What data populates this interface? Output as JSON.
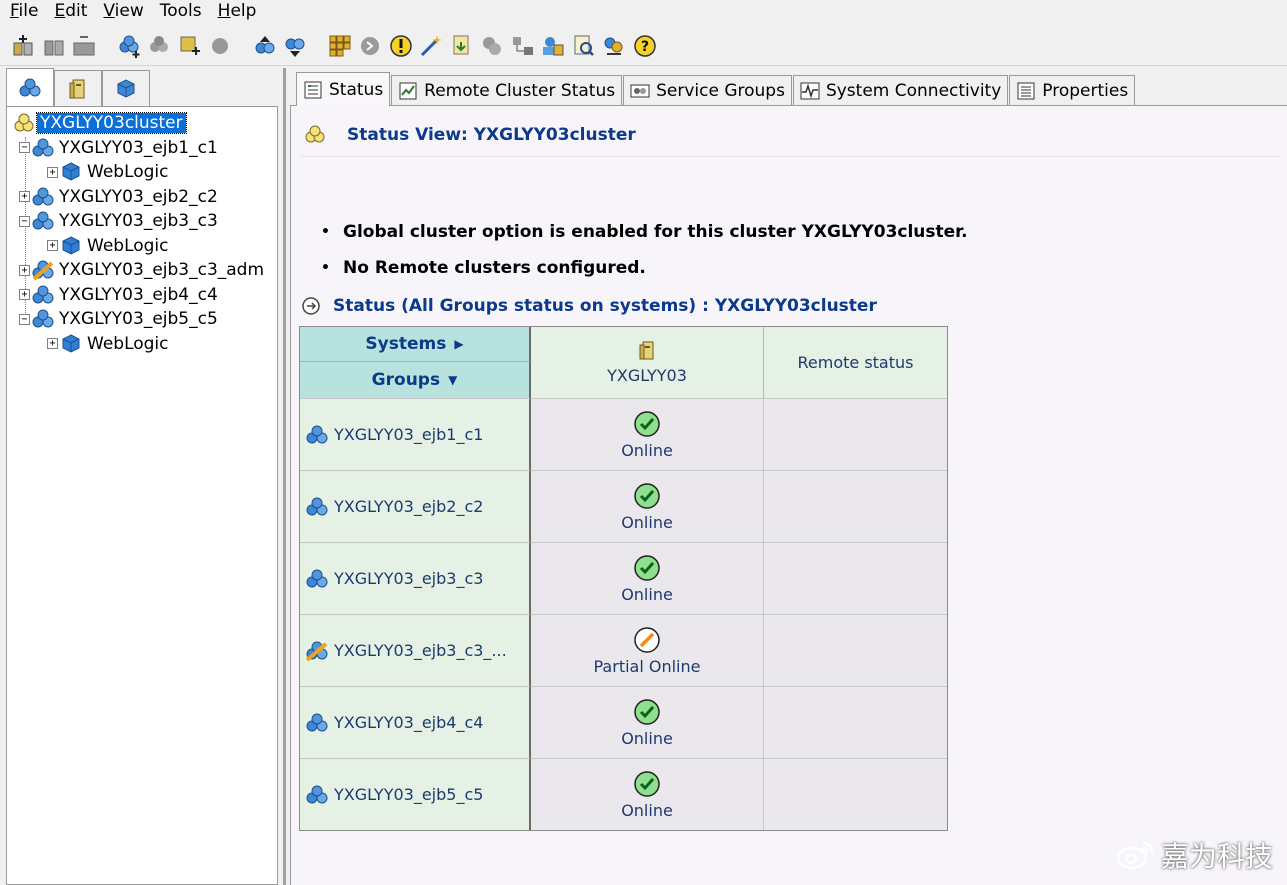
{
  "menu": [
    {
      "mnemonic": "F",
      "rest": "ile"
    },
    {
      "mnemonic": "E",
      "rest": "dit"
    },
    {
      "mnemonic": "V",
      "rest": "iew"
    },
    {
      "mnemonic": "",
      "rest": "Tools"
    },
    {
      "mnemonic": "H",
      "rest": "elp"
    }
  ],
  "tree": {
    "root": "YXGLYY03cluster",
    "items": [
      {
        "label": "YXGLYY03_ejb1_c1",
        "expander": "−",
        "state": "online"
      },
      {
        "label": "WebLogic",
        "expander": "+",
        "child": true
      },
      {
        "label": "YXGLYY03_ejb2_c2",
        "expander": "+",
        "state": "online"
      },
      {
        "label": "YXGLYY03_ejb3_c3",
        "expander": "−",
        "state": "online"
      },
      {
        "label": "WebLogic",
        "expander": "+",
        "child": true
      },
      {
        "label": "YXGLYY03_ejb3_c3_adm",
        "expander": "+",
        "state": "partial"
      },
      {
        "label": "YXGLYY03_ejb4_c4",
        "expander": "+",
        "state": "online"
      },
      {
        "label": "YXGLYY03_ejb5_c5",
        "expander": "−",
        "state": "online"
      },
      {
        "label": "WebLogic",
        "expander": "+",
        "child": true
      }
    ]
  },
  "tabs": [
    {
      "label": "Status",
      "icon": "status-icon",
      "active": true
    },
    {
      "label": "Remote Cluster Status",
      "icon": "remote-cluster-icon"
    },
    {
      "label": "Service Groups",
      "icon": "service-groups-icon"
    },
    {
      "label": "System Connectivity",
      "icon": "connectivity-icon"
    },
    {
      "label": "Properties",
      "icon": "properties-icon"
    }
  ],
  "status_view": {
    "title": "Status View:  YXGLYY03cluster",
    "bullets": [
      "Global cluster option is enabled for this cluster YXGLYY03cluster.",
      "No Remote clusters configured."
    ],
    "section_title": "Status (All Groups status on systems) : YXGLYY03cluster"
  },
  "table": {
    "systems_label": "Systems",
    "groups_label": "Groups",
    "system_name": "YXGLYY03",
    "remote_label": "Remote status",
    "rows": [
      {
        "group": "YXGLYY03_ejb1_c1",
        "status": "Online",
        "kind": "online"
      },
      {
        "group": "YXGLYY03_ejb2_c2",
        "status": "Online",
        "kind": "online"
      },
      {
        "group": "YXGLYY03_ejb3_c3",
        "status": "Online",
        "kind": "online"
      },
      {
        "group": "YXGLYY03_ejb3_c3_...",
        "status": "Partial Online",
        "kind": "partial"
      },
      {
        "group": "YXGLYY03_ejb4_c4",
        "status": "Online",
        "kind": "online"
      },
      {
        "group": "YXGLYY03_ejb5_c5",
        "status": "Online",
        "kind": "online"
      }
    ]
  },
  "watermark": "嘉为科技",
  "colors": {
    "accent_blue": "#0b3a8a",
    "header_teal": "#b8e2dd",
    "group_cell": "#e4f1e4",
    "online_green": "#2fa84f",
    "partial_orange": "#f08a1c",
    "selected_bg": "#0a6fd6"
  }
}
